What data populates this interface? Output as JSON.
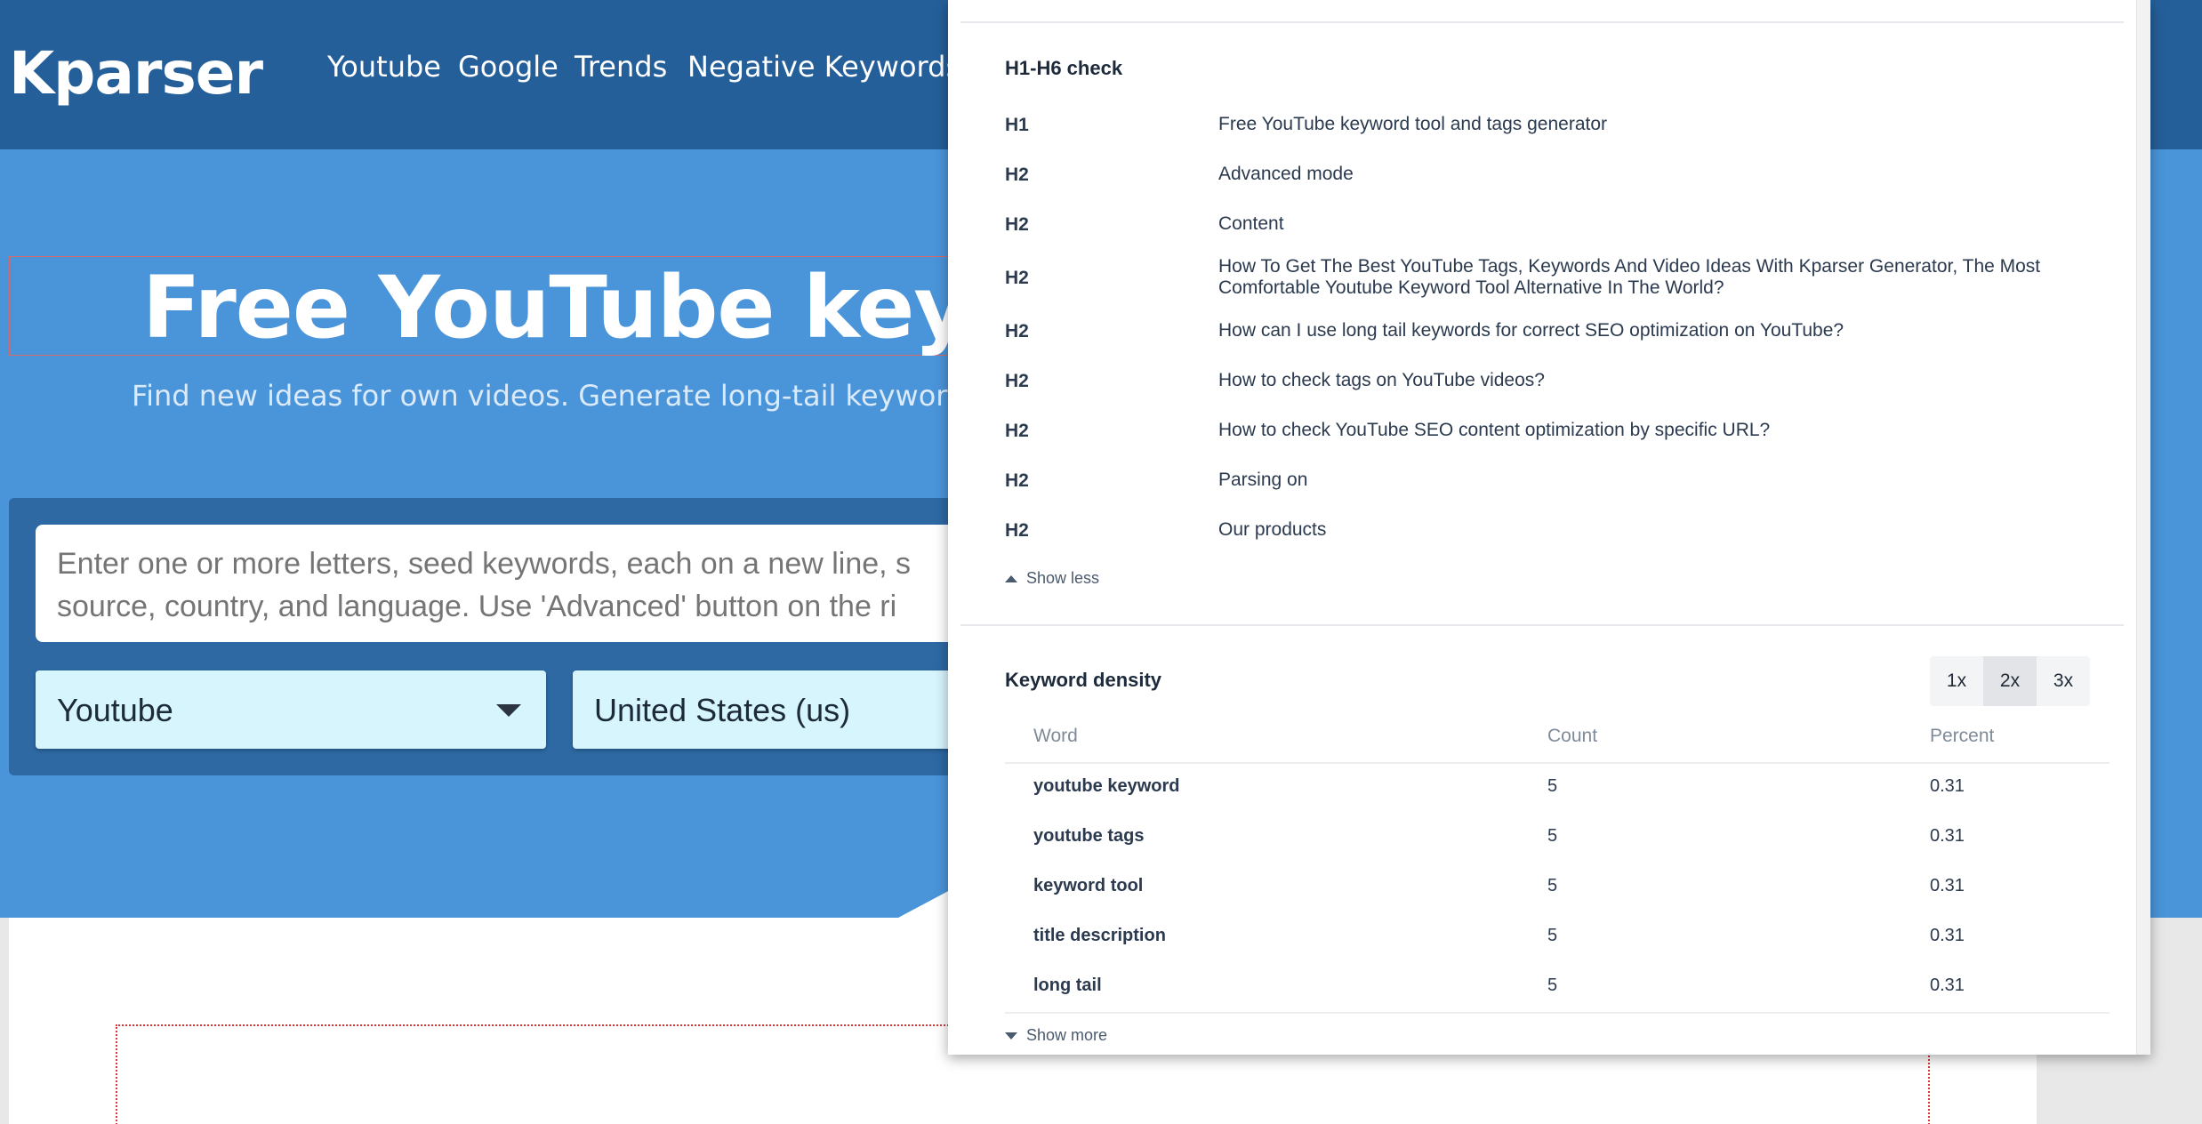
{
  "site": {
    "logo": "Kparser",
    "nav": [
      "Youtube",
      "Google",
      "Trends",
      "Negative Keywords"
    ],
    "hero_title_prefix": "Free",
    "hero_title_bold": "YouTube",
    "hero_title_suffix": "keywor",
    "hero_subtitle": "Find new ideas for own videos. Generate long-tail keyword sugges",
    "search_placeholder": "Enter one or more letters, seed keywords, each on a new line, s\nsource, country, and language. Use 'Advanced' button on the ri",
    "source_select": "Youtube",
    "country_select": "United States (us)"
  },
  "panel": {
    "headings_title": "H1-H6 check",
    "headings": [
      {
        "tag": "H1",
        "text": "Free YouTube keyword tool and tags generator"
      },
      {
        "tag": "H2",
        "text": "Advanced mode"
      },
      {
        "tag": "H2",
        "text": "Content"
      },
      {
        "tag": "H2",
        "text": "How To Get The Best YouTube Tags, Keywords And Video Ideas With Kparser Generator, The Most Comfortable Youtube Keyword Tool Alternative In The World?"
      },
      {
        "tag": "H2",
        "text": "How can I use long tail keywords for correct SEO optimization on YouTube?"
      },
      {
        "tag": "H2",
        "text": "How to check tags on YouTube videos?"
      },
      {
        "tag": "H2",
        "text": "How to check YouTube SEO content optimization by specific URL?"
      },
      {
        "tag": "H2",
        "text": "Parsing on"
      },
      {
        "tag": "H2",
        "text": "Our products"
      }
    ],
    "show_less": "Show less",
    "density_title": "Keyword density",
    "zoom_options": [
      "1x",
      "2x",
      "3x"
    ],
    "zoom_active": "2x",
    "columns": {
      "word": "Word",
      "count": "Count",
      "percent": "Percent"
    },
    "rows": [
      {
        "word": "youtube keyword",
        "count": "5",
        "percent": "0.31"
      },
      {
        "word": "youtube tags",
        "count": "5",
        "percent": "0.31"
      },
      {
        "word": "keyword tool",
        "count": "5",
        "percent": "0.31"
      },
      {
        "word": "title description",
        "count": "5",
        "percent": "0.31"
      },
      {
        "word": "long tail",
        "count": "5",
        "percent": "0.31"
      }
    ],
    "show_more": "Show more"
  }
}
